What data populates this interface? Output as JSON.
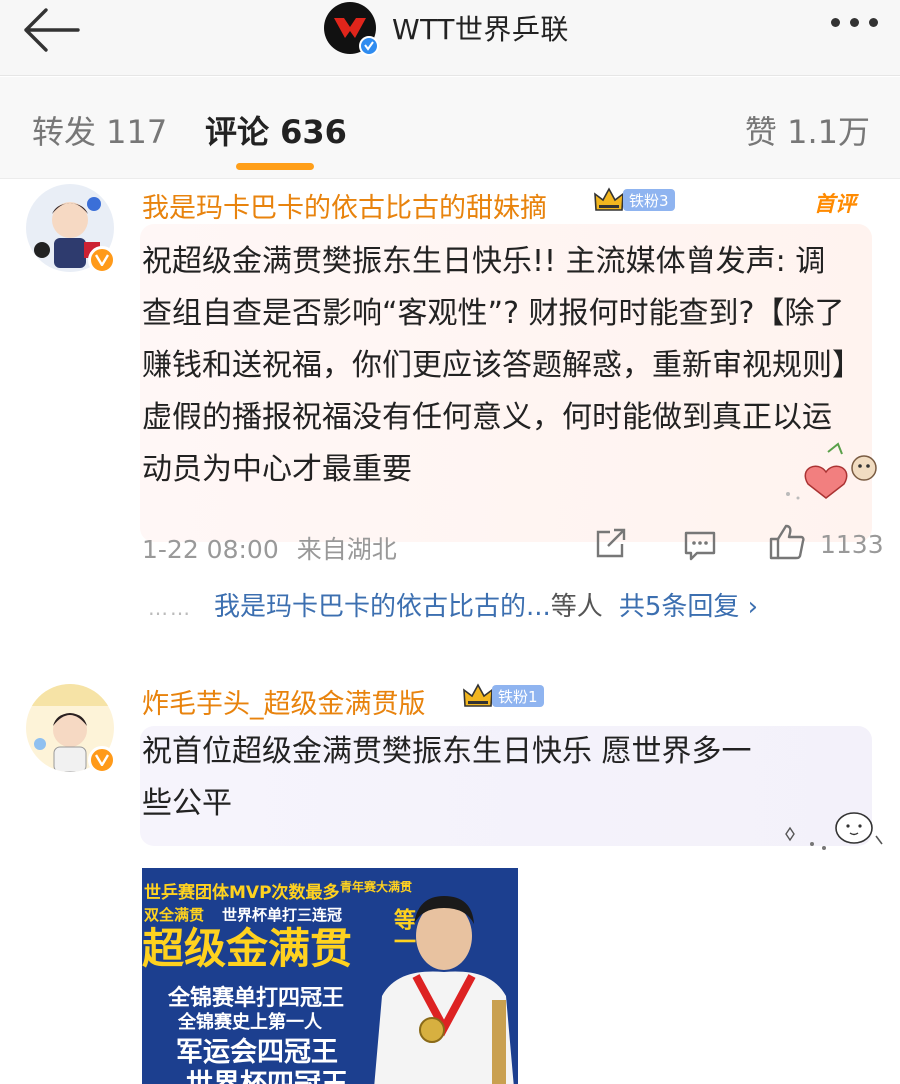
{
  "header": {
    "account_name": "WTT世界乒联",
    "back_icon": "arrow-left-icon",
    "more_icon": "more-dots-icon"
  },
  "tabs": {
    "repost": "转发 117",
    "comment": "评论 636",
    "like": "赞 1.1万",
    "active": "comment",
    "accent_color": "#ff9f1a"
  },
  "comments": [
    {
      "username": "我是玛卡巴卡的依古比古的甜妹摘",
      "fan_badge": "铁粉3",
      "tag": "首评",
      "text": "祝超级金满贯樊振东生日快乐!! 主流媒体曾发声: 调查组自查是否影响“客观性”? 财报何时能查到?【除了赚钱和送祝福，你们更应该答题解惑，重新审视规则】虚假的播报祝福没有任何意义，何时能做到真正以运动员为中心才最重要",
      "time": "1-22 08:00",
      "location": "来自湖北",
      "likes": "1133",
      "replies": {
        "dots": "……",
        "preview": "我是玛卡巴卡的依古比古的...",
        "etc": "等人",
        "total": "共5条回复 ›"
      }
    },
    {
      "username": "炸毛芋头_超级金满贯版",
      "fan_badge": "铁粉1",
      "text": "祝首位超级金满贯樊振东生日快乐 愿世界多一些公平",
      "image_text": {
        "line1": "世乒赛团体MVP次数最多",
        "line1b": "青年赛大满贯",
        "line2": "双全满贯",
        "line2b": "世界杯单打三连冠",
        "line3": "超级金满贯",
        "line3b": "等一",
        "line4": "全锦赛单打四冠王",
        "line5": "全锦赛史上第一人",
        "line6": "军运会四冠王",
        "line7": "世界杯四冠王"
      }
    }
  ]
}
